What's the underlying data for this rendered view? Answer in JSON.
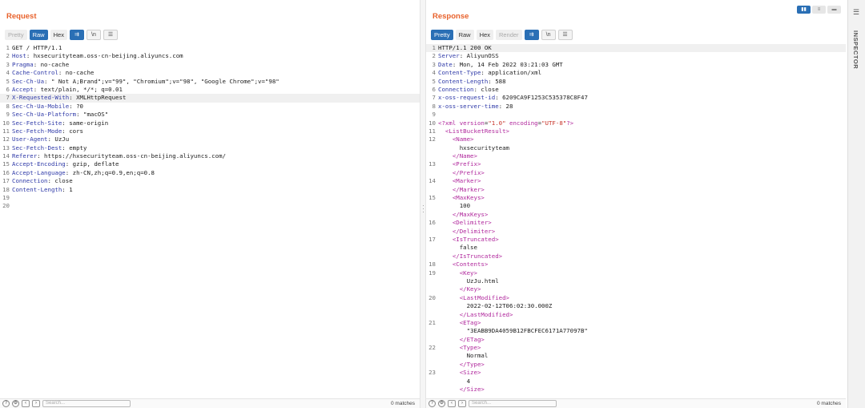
{
  "request": {
    "title": "Request",
    "tabs": [
      {
        "label": "Pretty",
        "state": "disabled"
      },
      {
        "label": "Raw",
        "state": "active"
      },
      {
        "label": "Hex",
        "state": "normal"
      }
    ],
    "icons": [
      "wrap-lines-icon",
      "newline-icon",
      "menu-icon"
    ],
    "icon_glyphs": [
      "⇉",
      "\\n",
      "☰"
    ],
    "lines": [
      {
        "n": "1",
        "parts": [
          [
            "plain",
            "GET / HTTP/1.1"
          ]
        ]
      },
      {
        "n": "2",
        "parts": [
          [
            "k",
            "Host"
          ],
          [
            "plain",
            ": hxsecurityteam.oss-cn-beijing.aliyuncs.com"
          ]
        ]
      },
      {
        "n": "3",
        "parts": [
          [
            "k",
            "Pragma"
          ],
          [
            "plain",
            ": no-cache"
          ]
        ]
      },
      {
        "n": "4",
        "parts": [
          [
            "k",
            "Cache-Control"
          ],
          [
            "plain",
            ": no-cache"
          ]
        ]
      },
      {
        "n": "5",
        "parts": [
          [
            "k",
            "Sec-Ch-Ua"
          ],
          [
            "plain",
            ": \" Not A;Brand\";v=\"99\", \"Chromium\";v=\"98\", \"Google Chrome\";v=\"98\""
          ]
        ]
      },
      {
        "n": "6",
        "parts": [
          [
            "k",
            "Accept"
          ],
          [
            "plain",
            ": text/plain, */*; q=0.01"
          ]
        ]
      },
      {
        "n": "7",
        "parts": [
          [
            "k",
            "X-Requested-With"
          ],
          [
            "plain",
            ": XMLHttpRequest"
          ]
        ],
        "hl": true
      },
      {
        "n": "8",
        "parts": [
          [
            "k",
            "Sec-Ch-Ua-Mobile"
          ],
          [
            "plain",
            ": ?0"
          ]
        ]
      },
      {
        "n": "9",
        "parts": [
          [
            "k",
            "Sec-Ch-Ua-Platform"
          ],
          [
            "plain",
            ": \"macOS\""
          ]
        ]
      },
      {
        "n": "10",
        "parts": [
          [
            "k",
            "Sec-Fetch-Site"
          ],
          [
            "plain",
            ": same-origin"
          ]
        ]
      },
      {
        "n": "11",
        "parts": [
          [
            "k",
            "Sec-Fetch-Mode"
          ],
          [
            "plain",
            ": cors"
          ]
        ]
      },
      {
        "n": "12",
        "parts": [
          [
            "k",
            "User-Agent"
          ],
          [
            "plain",
            ": UzJu"
          ]
        ]
      },
      {
        "n": "13",
        "parts": [
          [
            "k",
            "Sec-Fetch-Dest"
          ],
          [
            "plain",
            ": empty"
          ]
        ]
      },
      {
        "n": "14",
        "parts": [
          [
            "k",
            "Referer"
          ],
          [
            "plain",
            ": https://hxsecurityteam.oss-cn-beijing.aliyuncs.com/"
          ]
        ]
      },
      {
        "n": "15",
        "parts": [
          [
            "k",
            "Accept-Encoding"
          ],
          [
            "plain",
            ": gzip, deflate"
          ]
        ]
      },
      {
        "n": "16",
        "parts": [
          [
            "k",
            "Accept-Language"
          ],
          [
            "plain",
            ": zh-CN,zh;q=0.9,en;q=0.8"
          ]
        ]
      },
      {
        "n": "17",
        "parts": [
          [
            "k",
            "Connection"
          ],
          [
            "plain",
            ": close"
          ]
        ]
      },
      {
        "n": "18",
        "parts": [
          [
            "k",
            "Content-Length"
          ],
          [
            "plain",
            ": 1"
          ]
        ]
      },
      {
        "n": "19",
        "parts": [
          [
            "plain",
            ""
          ]
        ]
      },
      {
        "n": "20",
        "parts": [
          [
            "plain",
            ""
          ]
        ]
      }
    ],
    "search_placeholder": "Search...",
    "matches": "0 matches"
  },
  "response": {
    "title": "Response",
    "tabs": [
      {
        "label": "Pretty",
        "state": "active"
      },
      {
        "label": "Raw",
        "state": "normal"
      },
      {
        "label": "Hex",
        "state": "normal"
      },
      {
        "label": "Render",
        "state": "disabled"
      }
    ],
    "icons": [
      "wrap-lines-icon",
      "newline-icon",
      "menu-icon"
    ],
    "icon_glyphs": [
      "⇉",
      "\\n",
      "☰"
    ],
    "lines": [
      {
        "n": "1",
        "parts": [
          [
            "plain",
            "HTTP/1.1 200 OK"
          ]
        ],
        "hl": true
      },
      {
        "n": "2",
        "parts": [
          [
            "k",
            "Server"
          ],
          [
            "plain",
            ": AliyunOSS"
          ]
        ]
      },
      {
        "n": "3",
        "parts": [
          [
            "k",
            "Date"
          ],
          [
            "plain",
            ": Mon, 14 Feb 2022 03:21:03 GMT"
          ]
        ]
      },
      {
        "n": "4",
        "parts": [
          [
            "k",
            "Content-Type"
          ],
          [
            "plain",
            ": application/xml"
          ]
        ]
      },
      {
        "n": "5",
        "parts": [
          [
            "k",
            "Content-Length"
          ],
          [
            "plain",
            ": 588"
          ]
        ]
      },
      {
        "n": "6",
        "parts": [
          [
            "k",
            "Connection"
          ],
          [
            "plain",
            ": close"
          ]
        ]
      },
      {
        "n": "7",
        "parts": [
          [
            "k",
            "x-oss-request-id"
          ],
          [
            "plain",
            ": 6209CA9F1253C535378C8F47"
          ]
        ]
      },
      {
        "n": "8",
        "parts": [
          [
            "k",
            "x-oss-server-time"
          ],
          [
            "plain",
            ": 28"
          ]
        ]
      },
      {
        "n": "9",
        "parts": [
          [
            "plain",
            ""
          ]
        ]
      },
      {
        "n": "10",
        "parts": [
          [
            "tg",
            "<?xml "
          ],
          [
            "attr",
            "version"
          ],
          [
            "plain",
            "="
          ],
          [
            "str",
            "\"1.0\""
          ],
          [
            "plain",
            " "
          ],
          [
            "attr",
            "encoding"
          ],
          [
            "plain",
            "="
          ],
          [
            "str",
            "\"UTF-8\""
          ],
          [
            "tg",
            "?>"
          ]
        ]
      },
      {
        "n": "11",
        "parts": [
          [
            "plain",
            "  "
          ],
          [
            "tg",
            "<ListBucketResult>"
          ]
        ]
      },
      {
        "n": "12",
        "parts": [
          [
            "plain",
            "    "
          ],
          [
            "tg",
            "<Name>"
          ]
        ]
      },
      {
        "n": "",
        "parts": [
          [
            "plain",
            "      hxsecurityteam"
          ]
        ]
      },
      {
        "n": "",
        "parts": [
          [
            "plain",
            "    "
          ],
          [
            "tg",
            "</Name>"
          ]
        ]
      },
      {
        "n": "13",
        "parts": [
          [
            "plain",
            "    "
          ],
          [
            "tg",
            "<Prefix>"
          ]
        ]
      },
      {
        "n": "",
        "parts": [
          [
            "plain",
            "    "
          ],
          [
            "tg",
            "</Prefix>"
          ]
        ]
      },
      {
        "n": "14",
        "parts": [
          [
            "plain",
            "    "
          ],
          [
            "tg",
            "<Marker>"
          ]
        ]
      },
      {
        "n": "",
        "parts": [
          [
            "plain",
            "    "
          ],
          [
            "tg",
            "</Marker>"
          ]
        ]
      },
      {
        "n": "15",
        "parts": [
          [
            "plain",
            "    "
          ],
          [
            "tg",
            "<MaxKeys>"
          ]
        ]
      },
      {
        "n": "",
        "parts": [
          [
            "plain",
            "      100"
          ]
        ]
      },
      {
        "n": "",
        "parts": [
          [
            "plain",
            "    "
          ],
          [
            "tg",
            "</MaxKeys>"
          ]
        ]
      },
      {
        "n": "16",
        "parts": [
          [
            "plain",
            "    "
          ],
          [
            "tg",
            "<Delimiter>"
          ]
        ]
      },
      {
        "n": "",
        "parts": [
          [
            "plain",
            "    "
          ],
          [
            "tg",
            "</Delimiter>"
          ]
        ]
      },
      {
        "n": "17",
        "parts": [
          [
            "plain",
            "    "
          ],
          [
            "tg",
            "<IsTruncated>"
          ]
        ]
      },
      {
        "n": "",
        "parts": [
          [
            "plain",
            "      false"
          ]
        ]
      },
      {
        "n": "",
        "parts": [
          [
            "plain",
            "    "
          ],
          [
            "tg",
            "</IsTruncated>"
          ]
        ]
      },
      {
        "n": "18",
        "parts": [
          [
            "plain",
            "    "
          ],
          [
            "tg",
            "<Contents>"
          ]
        ]
      },
      {
        "n": "19",
        "parts": [
          [
            "plain",
            "      "
          ],
          [
            "tg",
            "<Key>"
          ]
        ]
      },
      {
        "n": "",
        "parts": [
          [
            "plain",
            "        UzJu.html"
          ]
        ]
      },
      {
        "n": "",
        "parts": [
          [
            "plain",
            "      "
          ],
          [
            "tg",
            "</Key>"
          ]
        ]
      },
      {
        "n": "20",
        "parts": [
          [
            "plain",
            "      "
          ],
          [
            "tg",
            "<LastModified>"
          ]
        ]
      },
      {
        "n": "",
        "parts": [
          [
            "plain",
            "        2022-02-12T06:02:30.000Z"
          ]
        ]
      },
      {
        "n": "",
        "parts": [
          [
            "plain",
            "      "
          ],
          [
            "tg",
            "</LastModified>"
          ]
        ]
      },
      {
        "n": "21",
        "parts": [
          [
            "plain",
            "      "
          ],
          [
            "tg",
            "<ETag>"
          ]
        ]
      },
      {
        "n": "",
        "parts": [
          [
            "plain",
            "        \"3EABB9DA4059B12FBCFEC6171A77097B\""
          ]
        ]
      },
      {
        "n": "",
        "parts": [
          [
            "plain",
            "      "
          ],
          [
            "tg",
            "</ETag>"
          ]
        ]
      },
      {
        "n": "22",
        "parts": [
          [
            "plain",
            "      "
          ],
          [
            "tg",
            "<Type>"
          ]
        ]
      },
      {
        "n": "",
        "parts": [
          [
            "plain",
            "        Normal"
          ]
        ]
      },
      {
        "n": "",
        "parts": [
          [
            "plain",
            "      "
          ],
          [
            "tg",
            "</Type>"
          ]
        ]
      },
      {
        "n": "23",
        "parts": [
          [
            "plain",
            "      "
          ],
          [
            "tg",
            "<Size>"
          ]
        ]
      },
      {
        "n": "",
        "parts": [
          [
            "plain",
            "        4"
          ]
        ]
      },
      {
        "n": "",
        "parts": [
          [
            "plain",
            "      "
          ],
          [
            "tg",
            "</Size>"
          ]
        ]
      }
    ],
    "search_placeholder": "Search...",
    "matches": "0 matches"
  },
  "layout_switch": [
    "split-vertical-icon",
    "split-horizontal-icon",
    "tabs-view-icon"
  ],
  "inspector": {
    "label": "INSPECTOR",
    "menu_glyph": "☰"
  }
}
